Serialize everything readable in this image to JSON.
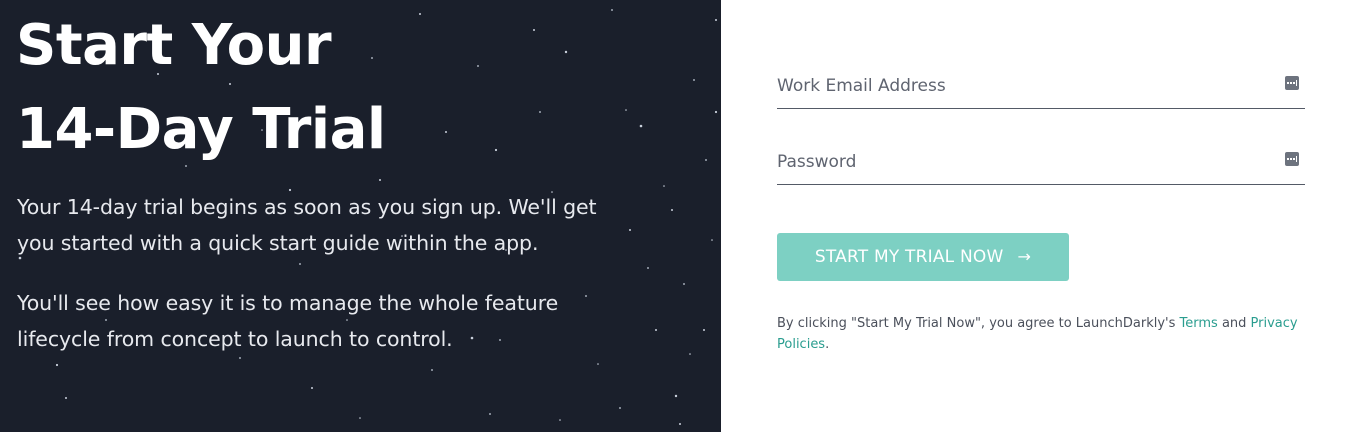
{
  "hero": {
    "title_line1": "Start Your",
    "title_line2": "14-Day Trial",
    "para1_line1": "Your 14-day trial begins as soon as you sign up. We'll get",
    "para1_line2": "you started with a quick start guide within the app.",
    "para2_line1": "You'll see how easy it is to manage the whole feature",
    "para2_line2": "lifecycle from concept to launch to control.",
    "background_color": "#1a1f2b"
  },
  "form": {
    "email": {
      "placeholder": "Work Email Address",
      "value": "",
      "icon": "password-manager-key-icon"
    },
    "password": {
      "placeholder": "Password",
      "value": "",
      "icon": "password-manager-key-icon"
    },
    "submit_label": "START MY TRIAL NOW",
    "submit_icon": "arrow-right-icon",
    "submit_color": "#7dd0c3"
  },
  "legal": {
    "prefix": "By clicking \"Start My Trial Now\", you agree to LaunchDarkly's ",
    "terms_link": "Terms",
    "conjunction": " and ",
    "privacy_link": "Privacy Policies",
    "suffix": ".",
    "link_color": "#2a9d8f"
  }
}
